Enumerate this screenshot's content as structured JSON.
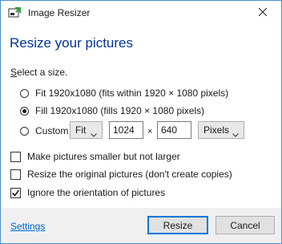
{
  "window": {
    "title": "Image Resizer",
    "close_glyph": "✕"
  },
  "heading": "Resize your pictures",
  "size_section": {
    "label": "Select a size.",
    "options": [
      {
        "label": "Fit 1920x1080 (fits within 1920 × 1080 pixels)",
        "selected": false
      },
      {
        "label": "Fill 1920x1080 (fills 1920 × 1080 pixels)",
        "selected": true
      },
      {
        "label": "Custom",
        "selected": false
      }
    ],
    "custom": {
      "mode_value": "Fit",
      "width_value": "1024",
      "times_symbol": "×",
      "height_value": "640",
      "unit_value": "Pixels"
    }
  },
  "checkboxes": [
    {
      "label": "Make pictures smaller but not larger",
      "checked": false
    },
    {
      "label": "Resize the original pictures (don't create copies)",
      "checked": false
    },
    {
      "label": "Ignore the orientation of pictures",
      "checked": true
    }
  ],
  "footer": {
    "settings_link": "Settings",
    "resize_button": "Resize",
    "cancel_button": "Cancel"
  },
  "colors": {
    "heading": "#003399",
    "link": "#0066cc",
    "accent_border": "#0078d7",
    "window_border": "#4a8fd1"
  },
  "icons": {
    "app": "image-resizer-app-icon",
    "close": "close-icon",
    "dropdown": "chevron-down-icon",
    "check": "checkmark-icon"
  }
}
